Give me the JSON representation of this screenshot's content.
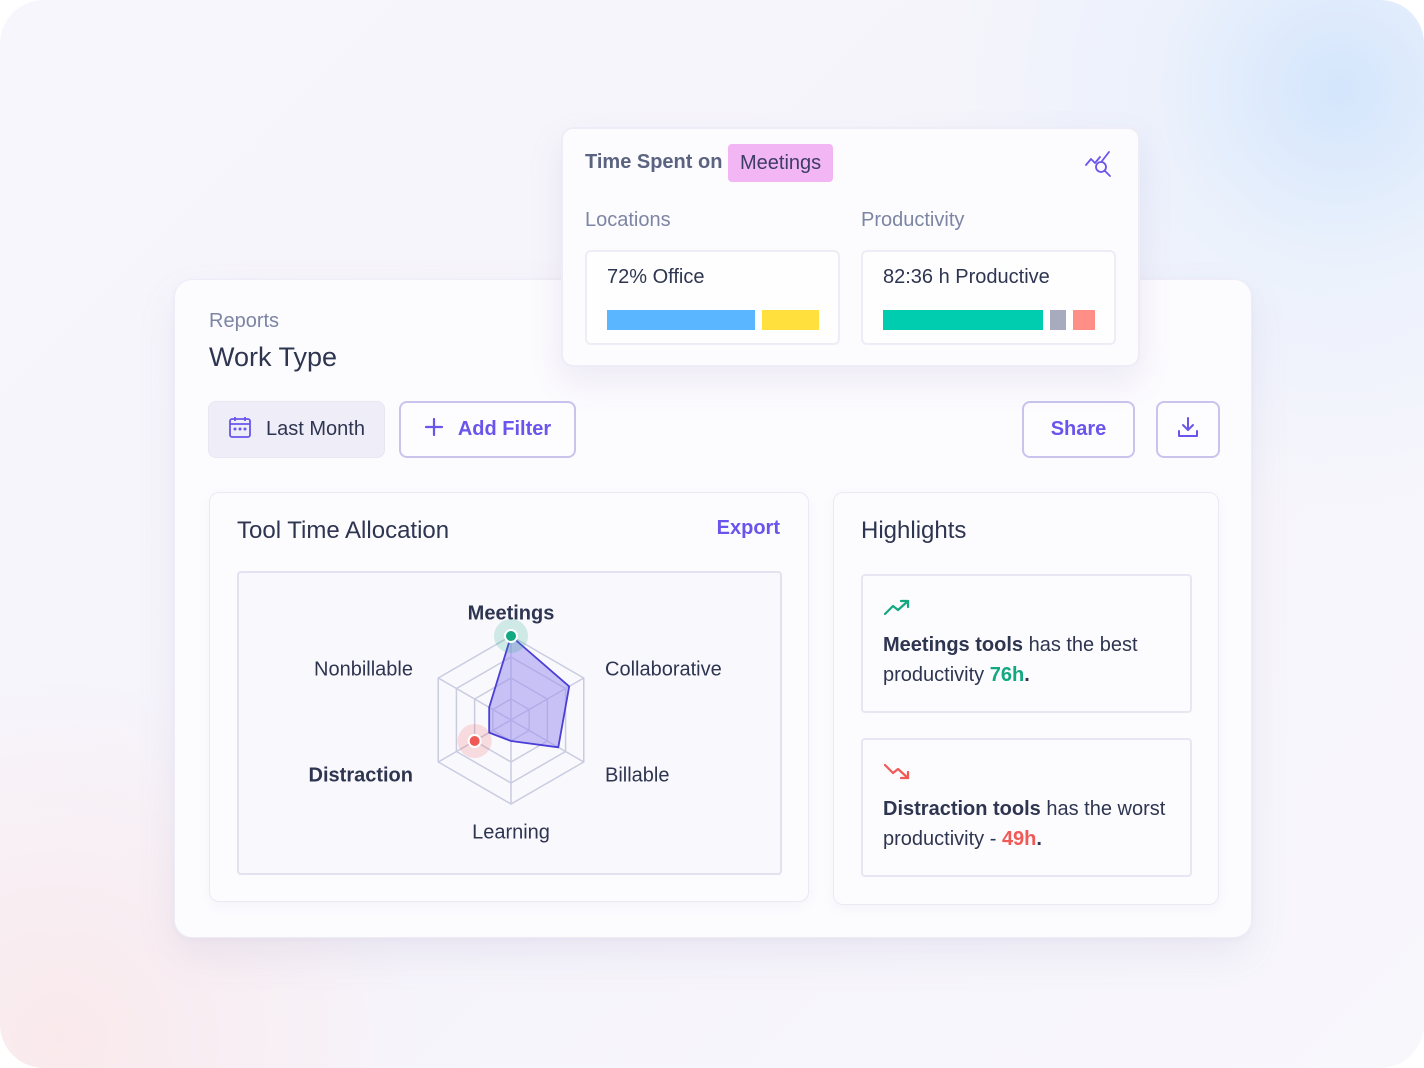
{
  "report": {
    "breadcrumb": "Reports",
    "title": "Work Type",
    "date_filter_label": "Last Month",
    "add_filter_label": "Add Filter",
    "share_label": "Share"
  },
  "icons": {
    "date": "calendar-icon",
    "add": "plus-icon",
    "download": "download-icon",
    "analytics": "chart-search-icon",
    "trend_up": "trend-up-icon",
    "trend_down": "trend-down-icon"
  },
  "tool_time": {
    "title": "Tool Time Allocation",
    "export_label": "Export"
  },
  "chart_data": {
    "type": "radar",
    "axes": [
      "Meetings",
      "Collaborative",
      "Billable",
      "Learning",
      "Distraction",
      "Nonbillable"
    ],
    "emphasized_axes": [
      "Meetings",
      "Distraction"
    ],
    "values": [
      1.0,
      0.8,
      0.65,
      0.25,
      0.3,
      0.3
    ],
    "rings": 4,
    "highlight_points": [
      {
        "axis": "Meetings",
        "value": 1.0,
        "color": "#12a882"
      },
      {
        "axis": "Distraction",
        "value": 0.5,
        "color": "#ef5a57"
      }
    ],
    "fill_color": "#9f93ee",
    "stroke_color": "#4b3fd6"
  },
  "highlights": {
    "title": "Highlights",
    "items": [
      {
        "bold": "Meetings tools",
        "text": " has the best productivity ",
        "value": "76h",
        "tail": ".",
        "trend": "up",
        "color": "#12a882"
      },
      {
        "bold": "Distraction tools",
        "text": " has the worst productivity - ",
        "value": "49h",
        "tail": ".",
        "trend": "down",
        "color": "#ef5a57"
      }
    ]
  },
  "time_spent": {
    "label": "Time Spent on",
    "tag": "Meetings",
    "locations_label": "Locations",
    "productivity_label": "Productivity",
    "locations_value": "72% Office",
    "productivity_value": "82:36 h Productive",
    "locations_bars": [
      {
        "share": 0.72,
        "color": "#5ab6ff"
      },
      {
        "share": 0.28,
        "color": "#ffe03d"
      }
    ],
    "productivity_bars": [
      {
        "share": 0.81,
        "color": "#00ccb0"
      },
      {
        "share": 0.08,
        "color": "#a8abbd"
      },
      {
        "share": 0.11,
        "color": "#ff8e86"
      }
    ]
  }
}
